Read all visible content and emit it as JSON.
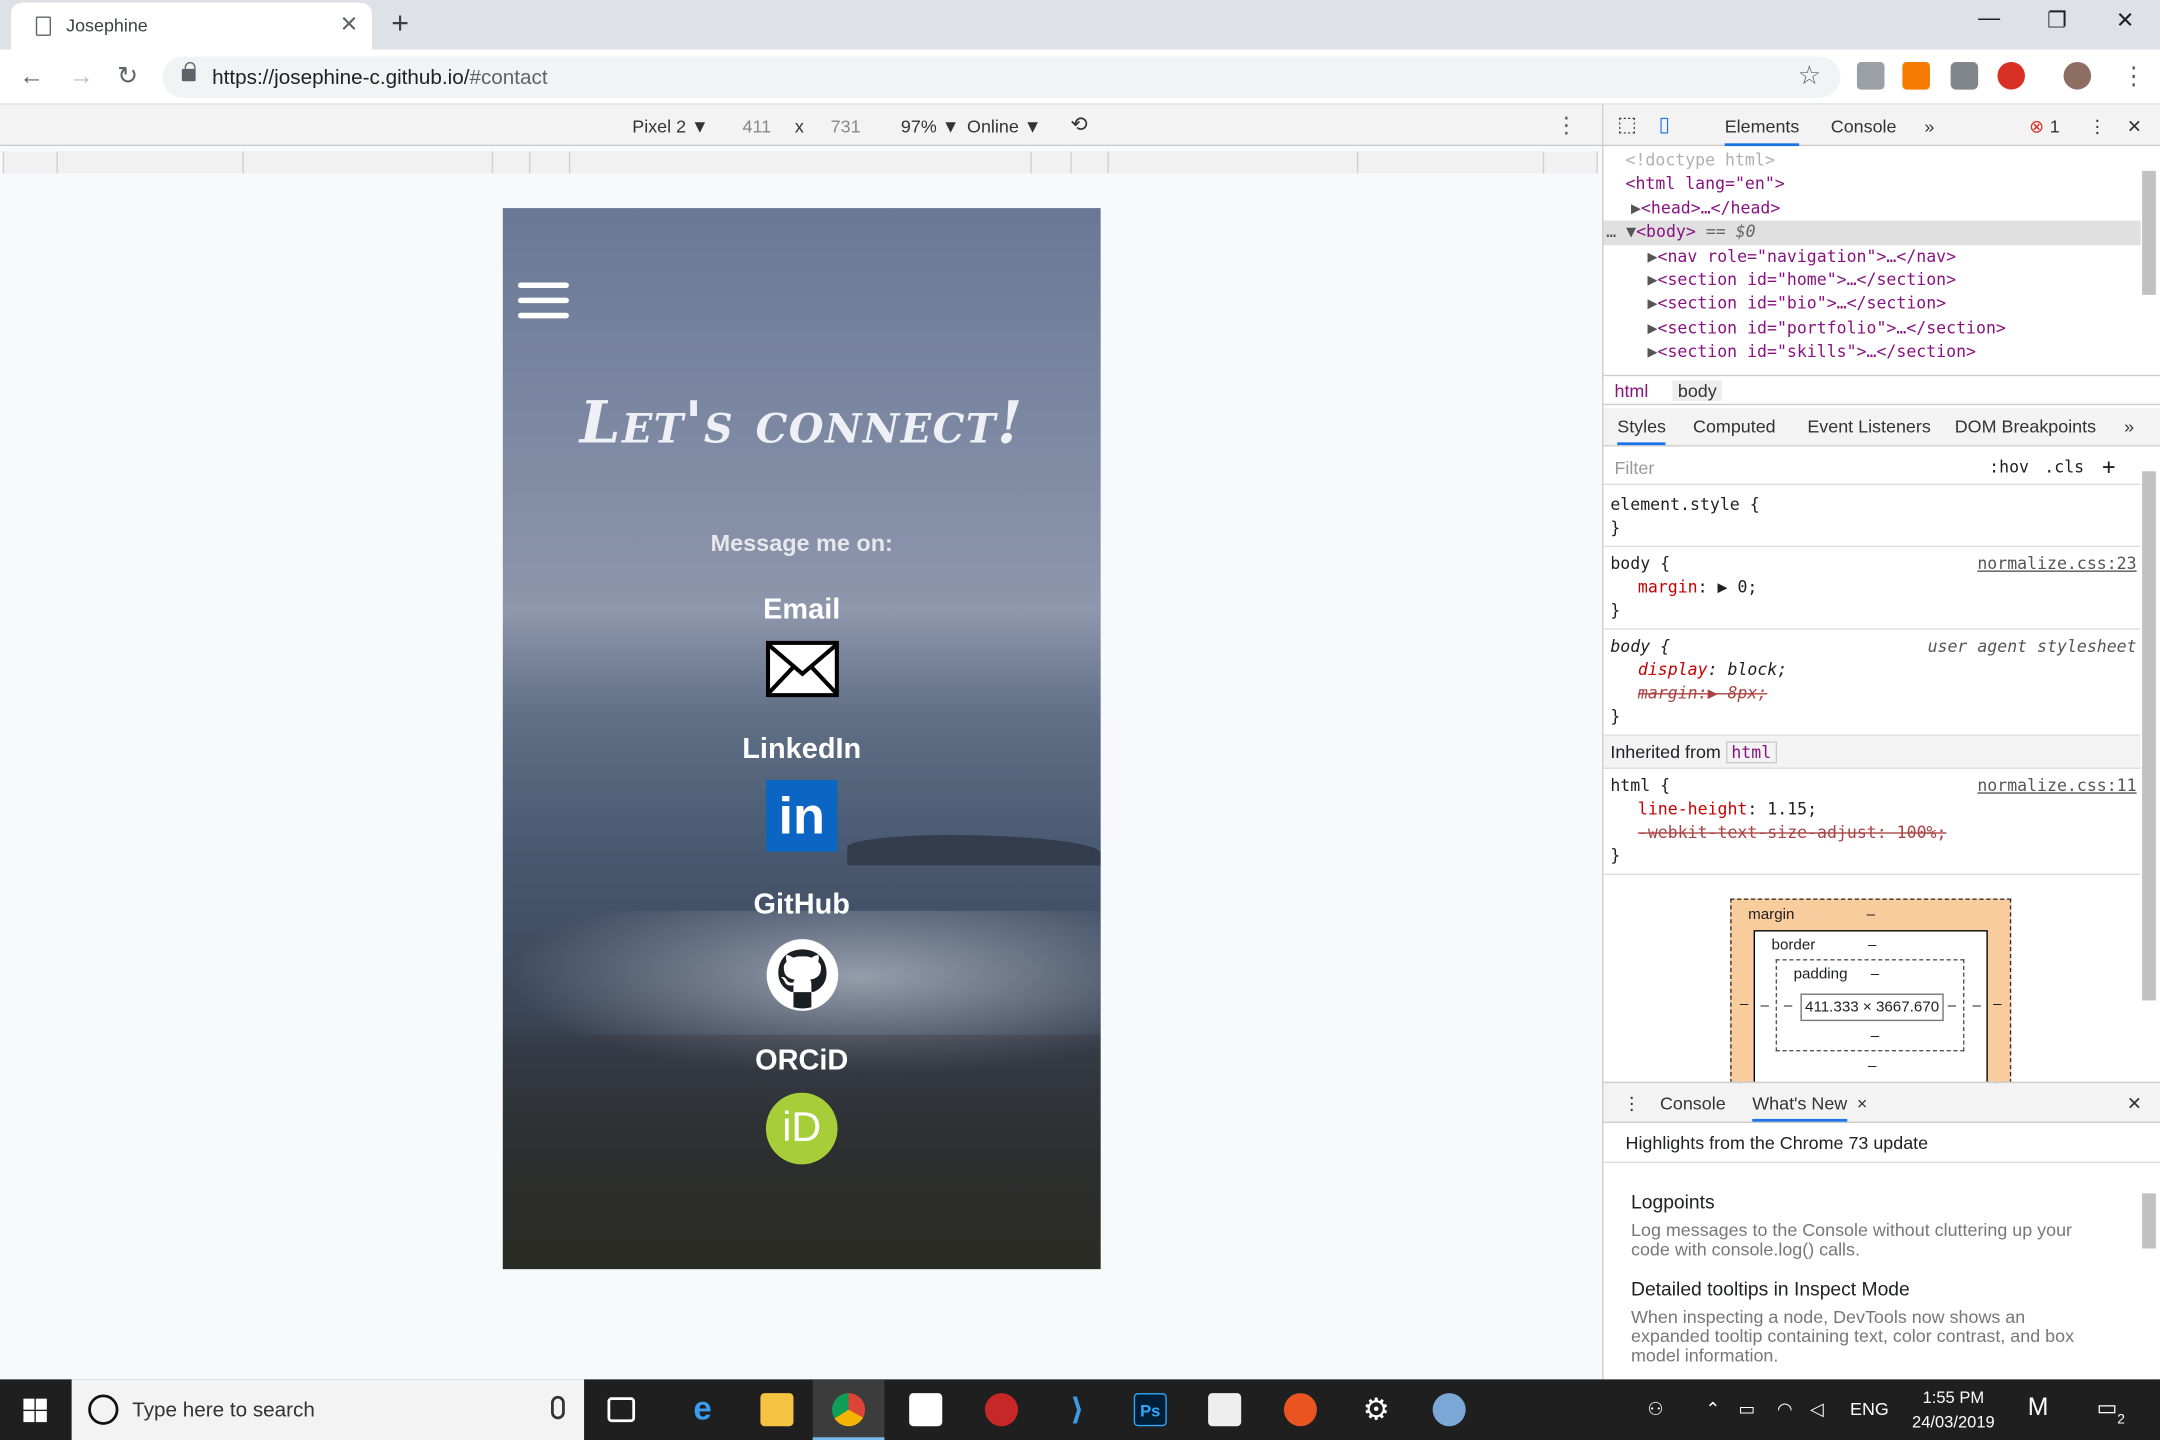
{
  "browser": {
    "tab_title": "Josephine",
    "url_main": "https://josephine-c.github.io/",
    "url_hash": "#contact"
  },
  "device_toolbar": {
    "device": "Pixel 2 ▼",
    "width": "411",
    "times": "x",
    "height": "731",
    "zoom": "97% ▼",
    "network": "Online ▼"
  },
  "page": {
    "title": "Let's connect!",
    "subtitle": "Message me on:",
    "contacts": [
      {
        "label": "Email"
      },
      {
        "label": "LinkedIn"
      },
      {
        "label": "GitHub"
      },
      {
        "label": "ORCiD"
      }
    ],
    "linkedin_glyph": "in",
    "orcid_glyph": "iD"
  },
  "devtools": {
    "tabs": {
      "elements": "Elements",
      "console": "Console",
      "more": "»",
      "errors": "1"
    },
    "dom": {
      "doctype": "<!doctype html>",
      "html_open": "<html lang=\"en\">",
      "head": "<head>…</head>",
      "body": "<body>",
      "body_eq": "== $0",
      "nav": "<nav role=\"navigation\">…</nav>",
      "sec_home": "<section id=\"home\">…</section>",
      "sec_bio": "<section id=\"bio\">…</section>",
      "sec_portfolio": "<section id=\"portfolio\">…</section>",
      "sec_skills": "<section id=\"skills\">…</section>"
    },
    "crumbs": [
      "html",
      "body"
    ],
    "style_tabs": [
      "Styles",
      "Computed",
      "Event Listeners",
      "DOM Breakpoints",
      "»"
    ],
    "filter_placeholder": "Filter",
    "hov": ":hov",
    "cls": ".cls",
    "add": "+",
    "rules": {
      "element_style": "element.style {",
      "close": "}",
      "body_sel": "body {",
      "normalize23": "normalize.css:23",
      "margin_prop": "margin",
      "margin_val": "▶ 0;",
      "ua_label": "user agent stylesheet",
      "display_prop": "display",
      "display_val": ": block;",
      "margin_struck": "margin:▶ 8px;",
      "inherited_from": "Inherited from",
      "inherited_chip": "html",
      "html_sel": "html {",
      "normalize11": "normalize.css:11",
      "lh_prop": "line-height",
      "lh_val": ": 1.15;",
      "webkit_struck": "-webkit-text-size-adjust: 100%;"
    },
    "box_model": {
      "margin": "margin",
      "border": "border",
      "padding": "padding",
      "dash": "–",
      "content": "411.333 × 3667.670"
    },
    "drawer": {
      "console": "Console",
      "whats_new": "What's New",
      "close": "×",
      "highlights": "Highlights from the Chrome 73 update",
      "items": [
        {
          "title": "Logpoints",
          "desc": "Log messages to the Console without cluttering up your code with console.log() calls."
        },
        {
          "title": "Detailed tooltips in Inspect Mode",
          "desc": "When inspecting a node, DevTools now shows an expanded tooltip containing text, color contrast, and box model information."
        }
      ]
    }
  },
  "taskbar": {
    "search_placeholder": "Type here to search",
    "lang": "ENG",
    "time": "1:55 PM",
    "date": "24/03/2019",
    "notif_count": "2"
  },
  "colors": {
    "linkedin": "#0a66c2",
    "orcid": "#a6ce39",
    "devtools_accent": "#1a73e8"
  }
}
